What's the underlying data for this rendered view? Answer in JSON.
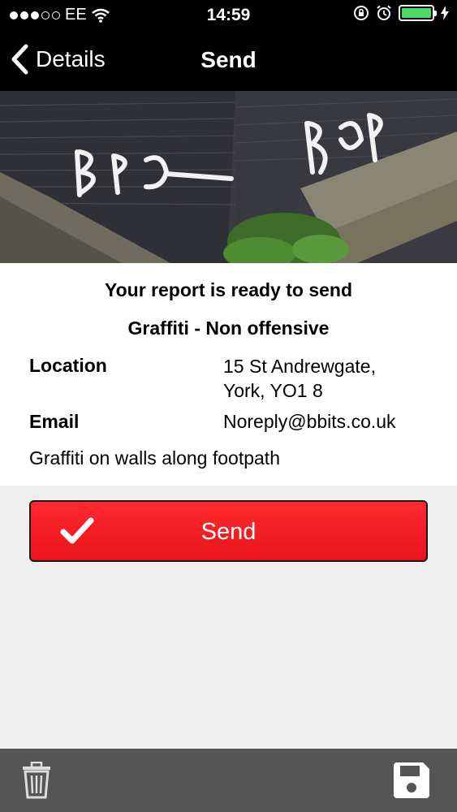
{
  "status_bar": {
    "carrier": "EE",
    "time": "14:59",
    "battery_level": 1.0
  },
  "nav": {
    "back_label": "Details",
    "title": "Send"
  },
  "report": {
    "ready_text": "Your report is ready to send",
    "category": "Graffiti - Non offensive",
    "location_label": "Location",
    "location_line1": "15 St Andrewgate,",
    "location_line2": "York, YO1 8",
    "email_label": "Email",
    "email_value": "Noreply@bbits.co.uk",
    "description": "Graffiti on walls along footpath"
  },
  "send_button": {
    "label": "Send",
    "icon": "checkmark-icon",
    "color": "#e8141b"
  },
  "toolbar": {
    "delete_icon": "trash-icon",
    "save_icon": "save-icon"
  }
}
